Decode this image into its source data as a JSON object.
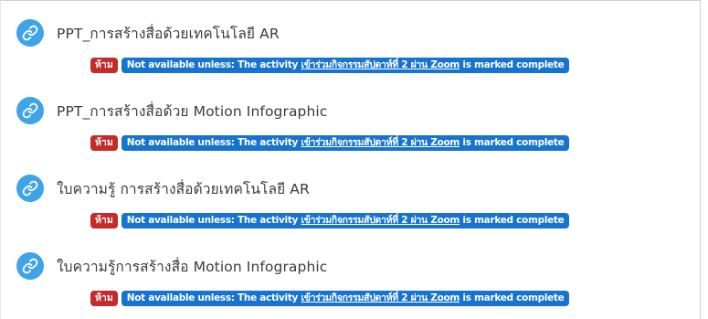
{
  "activities": [
    {
      "title": "PPT_การสร้างสื่อด้วยเทคโนโลยี AR",
      "restriction": {
        "badge": "ห้าม",
        "prefix": "Not available unless: The activity ",
        "link": "เข้าร่วมกิจกรรมสัปดาห์ที่ 2 ผ่าน Zoom",
        "suffix": " is marked complete"
      }
    },
    {
      "title": "PPT_การสร้างสื่อด้วย Motion Infographic",
      "restriction": {
        "badge": "ห้าม",
        "prefix": "Not available unless: The activity ",
        "link": "เข้าร่วมกิจกรรมสัปดาห์ที่ 2 ผ่าน Zoom",
        "suffix": " is marked complete"
      }
    },
    {
      "title": "ใบความรู้ การสร้างสื่อด้วยเทคโนโลยี AR",
      "restriction": {
        "badge": "ห้าม",
        "prefix": "Not available unless: The activity ",
        "link": "เข้าร่วมกิจกรรมสัปดาห์ที่ 2 ผ่าน Zoom",
        "suffix": " is marked complete"
      }
    },
    {
      "title": "ใบความรู้การสร้างสื่อ Motion Infographic",
      "restriction": {
        "badge": "ห้าม",
        "prefix": "Not available unless: The activity ",
        "link": "เข้าร่วมกิจกรรมสัปดาห์ที่ 2 ผ่าน Zoom",
        "suffix": " is marked complete"
      }
    }
  ],
  "icon": "link-icon",
  "colors": {
    "icon_bg": "#3fa3e6",
    "badge_red": "#c42b2b",
    "badge_blue": "#1673d0"
  }
}
